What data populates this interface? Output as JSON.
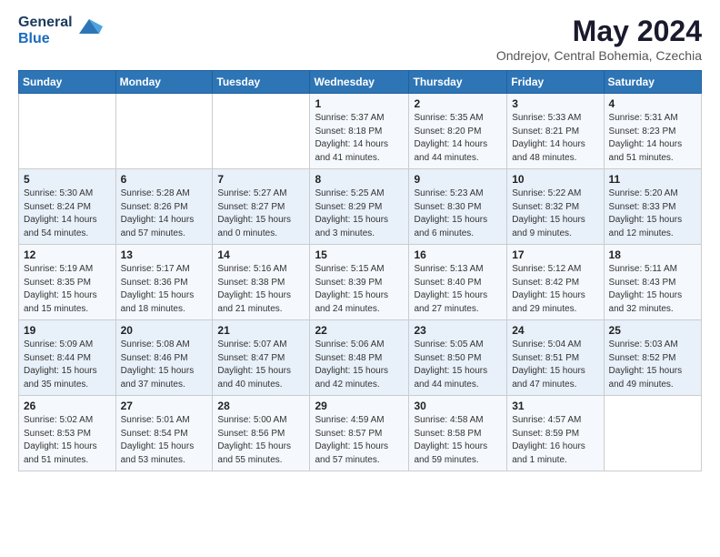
{
  "header": {
    "logo_general": "General",
    "logo_blue": "Blue",
    "month_year": "May 2024",
    "location": "Ondrejov, Central Bohemia, Czechia"
  },
  "weekdays": [
    "Sunday",
    "Monday",
    "Tuesday",
    "Wednesday",
    "Thursday",
    "Friday",
    "Saturday"
  ],
  "weeks": [
    [
      {
        "day": "",
        "info": ""
      },
      {
        "day": "",
        "info": ""
      },
      {
        "day": "",
        "info": ""
      },
      {
        "day": "1",
        "info": "Sunrise: 5:37 AM\nSunset: 8:18 PM\nDaylight: 14 hours\nand 41 minutes."
      },
      {
        "day": "2",
        "info": "Sunrise: 5:35 AM\nSunset: 8:20 PM\nDaylight: 14 hours\nand 44 minutes."
      },
      {
        "day": "3",
        "info": "Sunrise: 5:33 AM\nSunset: 8:21 PM\nDaylight: 14 hours\nand 48 minutes."
      },
      {
        "day": "4",
        "info": "Sunrise: 5:31 AM\nSunset: 8:23 PM\nDaylight: 14 hours\nand 51 minutes."
      }
    ],
    [
      {
        "day": "5",
        "info": "Sunrise: 5:30 AM\nSunset: 8:24 PM\nDaylight: 14 hours\nand 54 minutes."
      },
      {
        "day": "6",
        "info": "Sunrise: 5:28 AM\nSunset: 8:26 PM\nDaylight: 14 hours\nand 57 minutes."
      },
      {
        "day": "7",
        "info": "Sunrise: 5:27 AM\nSunset: 8:27 PM\nDaylight: 15 hours\nand 0 minutes."
      },
      {
        "day": "8",
        "info": "Sunrise: 5:25 AM\nSunset: 8:29 PM\nDaylight: 15 hours\nand 3 minutes."
      },
      {
        "day": "9",
        "info": "Sunrise: 5:23 AM\nSunset: 8:30 PM\nDaylight: 15 hours\nand 6 minutes."
      },
      {
        "day": "10",
        "info": "Sunrise: 5:22 AM\nSunset: 8:32 PM\nDaylight: 15 hours\nand 9 minutes."
      },
      {
        "day": "11",
        "info": "Sunrise: 5:20 AM\nSunset: 8:33 PM\nDaylight: 15 hours\nand 12 minutes."
      }
    ],
    [
      {
        "day": "12",
        "info": "Sunrise: 5:19 AM\nSunset: 8:35 PM\nDaylight: 15 hours\nand 15 minutes."
      },
      {
        "day": "13",
        "info": "Sunrise: 5:17 AM\nSunset: 8:36 PM\nDaylight: 15 hours\nand 18 minutes."
      },
      {
        "day": "14",
        "info": "Sunrise: 5:16 AM\nSunset: 8:38 PM\nDaylight: 15 hours\nand 21 minutes."
      },
      {
        "day": "15",
        "info": "Sunrise: 5:15 AM\nSunset: 8:39 PM\nDaylight: 15 hours\nand 24 minutes."
      },
      {
        "day": "16",
        "info": "Sunrise: 5:13 AM\nSunset: 8:40 PM\nDaylight: 15 hours\nand 27 minutes."
      },
      {
        "day": "17",
        "info": "Sunrise: 5:12 AM\nSunset: 8:42 PM\nDaylight: 15 hours\nand 29 minutes."
      },
      {
        "day": "18",
        "info": "Sunrise: 5:11 AM\nSunset: 8:43 PM\nDaylight: 15 hours\nand 32 minutes."
      }
    ],
    [
      {
        "day": "19",
        "info": "Sunrise: 5:09 AM\nSunset: 8:44 PM\nDaylight: 15 hours\nand 35 minutes."
      },
      {
        "day": "20",
        "info": "Sunrise: 5:08 AM\nSunset: 8:46 PM\nDaylight: 15 hours\nand 37 minutes."
      },
      {
        "day": "21",
        "info": "Sunrise: 5:07 AM\nSunset: 8:47 PM\nDaylight: 15 hours\nand 40 minutes."
      },
      {
        "day": "22",
        "info": "Sunrise: 5:06 AM\nSunset: 8:48 PM\nDaylight: 15 hours\nand 42 minutes."
      },
      {
        "day": "23",
        "info": "Sunrise: 5:05 AM\nSunset: 8:50 PM\nDaylight: 15 hours\nand 44 minutes."
      },
      {
        "day": "24",
        "info": "Sunrise: 5:04 AM\nSunset: 8:51 PM\nDaylight: 15 hours\nand 47 minutes."
      },
      {
        "day": "25",
        "info": "Sunrise: 5:03 AM\nSunset: 8:52 PM\nDaylight: 15 hours\nand 49 minutes."
      }
    ],
    [
      {
        "day": "26",
        "info": "Sunrise: 5:02 AM\nSunset: 8:53 PM\nDaylight: 15 hours\nand 51 minutes."
      },
      {
        "day": "27",
        "info": "Sunrise: 5:01 AM\nSunset: 8:54 PM\nDaylight: 15 hours\nand 53 minutes."
      },
      {
        "day": "28",
        "info": "Sunrise: 5:00 AM\nSunset: 8:56 PM\nDaylight: 15 hours\nand 55 minutes."
      },
      {
        "day": "29",
        "info": "Sunrise: 4:59 AM\nSunset: 8:57 PM\nDaylight: 15 hours\nand 57 minutes."
      },
      {
        "day": "30",
        "info": "Sunrise: 4:58 AM\nSunset: 8:58 PM\nDaylight: 15 hours\nand 59 minutes."
      },
      {
        "day": "31",
        "info": "Sunrise: 4:57 AM\nSunset: 8:59 PM\nDaylight: 16 hours\nand 1 minute."
      },
      {
        "day": "",
        "info": ""
      }
    ]
  ]
}
